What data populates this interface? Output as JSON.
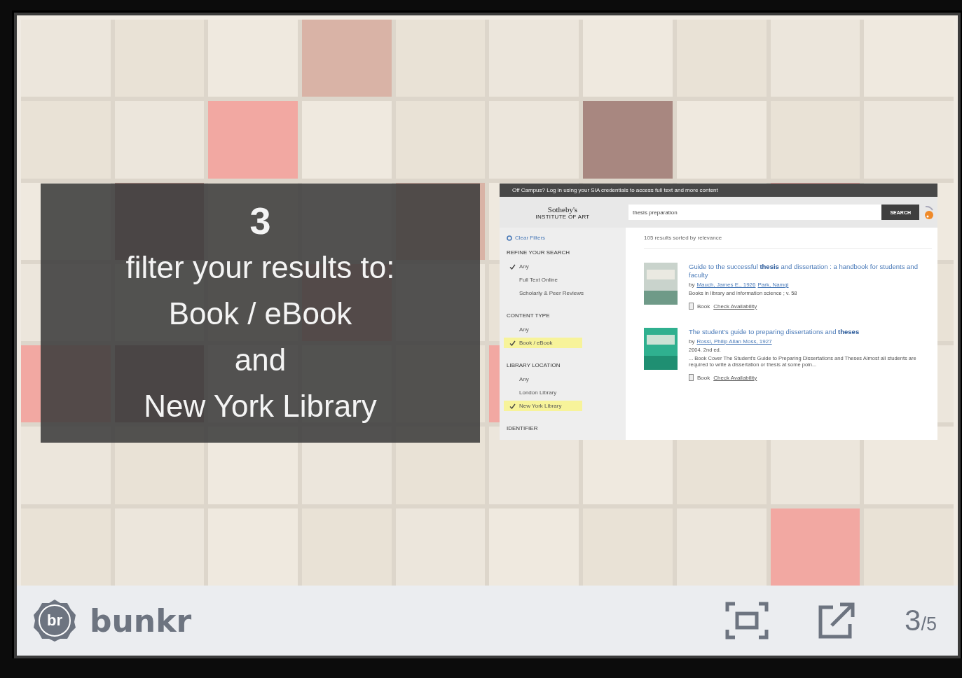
{
  "slide": {
    "number": "3",
    "caption_lines": [
      "filter your results to:",
      "Book / eBook",
      "and",
      "New York Library"
    ]
  },
  "library_screenshot": {
    "banner": "Off Campus? Log in using your SIA credentials to access full text and more content",
    "logo_lines": [
      "Sotheby's",
      "INSTITUTE OF ART"
    ],
    "search": {
      "value": "thesis preparation"
    },
    "search_button": "SEARCH",
    "clear_filters": "Clear Filters",
    "filter_groups": [
      {
        "heading": "REFINE YOUR SEARCH",
        "options": [
          {
            "label": "Any",
            "checked": true,
            "highlighted": false
          },
          {
            "label": "Full Text Online",
            "checked": false,
            "highlighted": false
          },
          {
            "label": "Scholarly & Peer Reviews",
            "checked": false,
            "highlighted": false
          }
        ]
      },
      {
        "heading": "CONTENT TYPE",
        "options": [
          {
            "label": "Any",
            "checked": false,
            "highlighted": false
          },
          {
            "label": "Book / eBook",
            "checked": true,
            "highlighted": true
          }
        ]
      },
      {
        "heading": "LIBRARY LOCATION",
        "options": [
          {
            "label": "Any",
            "checked": false,
            "highlighted": false
          },
          {
            "label": "London Library",
            "checked": false,
            "highlighted": false
          },
          {
            "label": "New York Library",
            "checked": true,
            "highlighted": true
          }
        ]
      }
    ],
    "trailing_heading": "IDENTIFIER",
    "results_summary": "105 results sorted by relevance",
    "results": [
      {
        "title": "Guide to the successful **thesis** and dissertation : a handbook for students and faculty",
        "byline": "by",
        "authors": [
          "Mauch, James E., 1926",
          "Park, Namgi"
        ],
        "details": [
          "Books in library and information science ; v. 58"
        ],
        "format": "Book",
        "availability": "Check Availability"
      },
      {
        "title": "The student's guide to preparing dissertations and **theses**",
        "byline": "by",
        "authors": [
          "Rossi, Philip Allan Moss, 1927"
        ],
        "details": [
          "2004. 2nd ed.",
          "... Book Cover The Student's Guide to Preparing Dissertations and Theses Almost all students are required to write a dissertation or thesis at some poin..."
        ],
        "format": "Book",
        "availability": "Check Availability"
      }
    ]
  },
  "viewer_bar": {
    "brand": "bunkr",
    "logo_text": "br",
    "page_current": "3",
    "page_total": "/5"
  }
}
